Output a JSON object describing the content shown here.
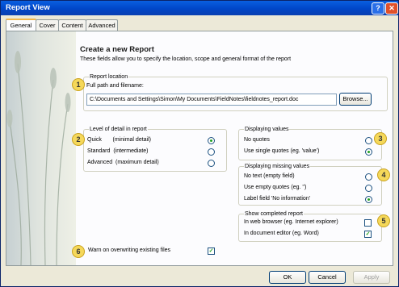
{
  "window": {
    "title": "Report View",
    "help_glyph": "?",
    "close_glyph": "✕"
  },
  "tabs": [
    "General",
    "Cover",
    "Content",
    "Advanced"
  ],
  "header": {
    "title": "Create a new Report",
    "subtitle": "These fields allow you to specify the location, scope and general format of the report"
  },
  "location": {
    "legend": "Report location",
    "label": "Full path and filename:",
    "value": "C:\\Documents and Settings\\Simon\\My Documents\\FieldNotes\\fieldnotes_report.doc",
    "browse": "Browse..."
  },
  "detail": {
    "legend": "Level of detail in report",
    "options": [
      {
        "label": "Quick",
        "hint": "(minimal detail)",
        "selected": true
      },
      {
        "label": "Standard",
        "hint": "(intermediate)",
        "selected": false
      },
      {
        "label": "Advanced",
        "hint": "(maximum detail)",
        "selected": false
      }
    ]
  },
  "display_values": {
    "legend": "Displaying values",
    "options": [
      {
        "label": "No quotes",
        "selected": false
      },
      {
        "label": "Use single quotes (eg. 'value')",
        "selected": true
      }
    ]
  },
  "missing_values": {
    "legend": "Displaying missing values",
    "options": [
      {
        "label": "No text (empty field)",
        "selected": false
      },
      {
        "label": "Use empty quotes (eg. '')",
        "selected": false
      },
      {
        "label": "Label field 'No information'",
        "selected": true
      }
    ]
  },
  "show_report": {
    "legend": "Show completed report",
    "options": [
      {
        "label": "In web browser (eg. Internet explorer)",
        "checked": false
      },
      {
        "label": "In document editor (eg. Word)",
        "checked": true
      }
    ]
  },
  "warn": {
    "label": "Warn on overwriting existing files",
    "checked": true
  },
  "badges": [
    "1",
    "2",
    "3",
    "4",
    "5",
    "6"
  ],
  "buttons": {
    "ok": "OK",
    "cancel": "Cancel",
    "apply": "Apply"
  },
  "check_glyph": "✓"
}
